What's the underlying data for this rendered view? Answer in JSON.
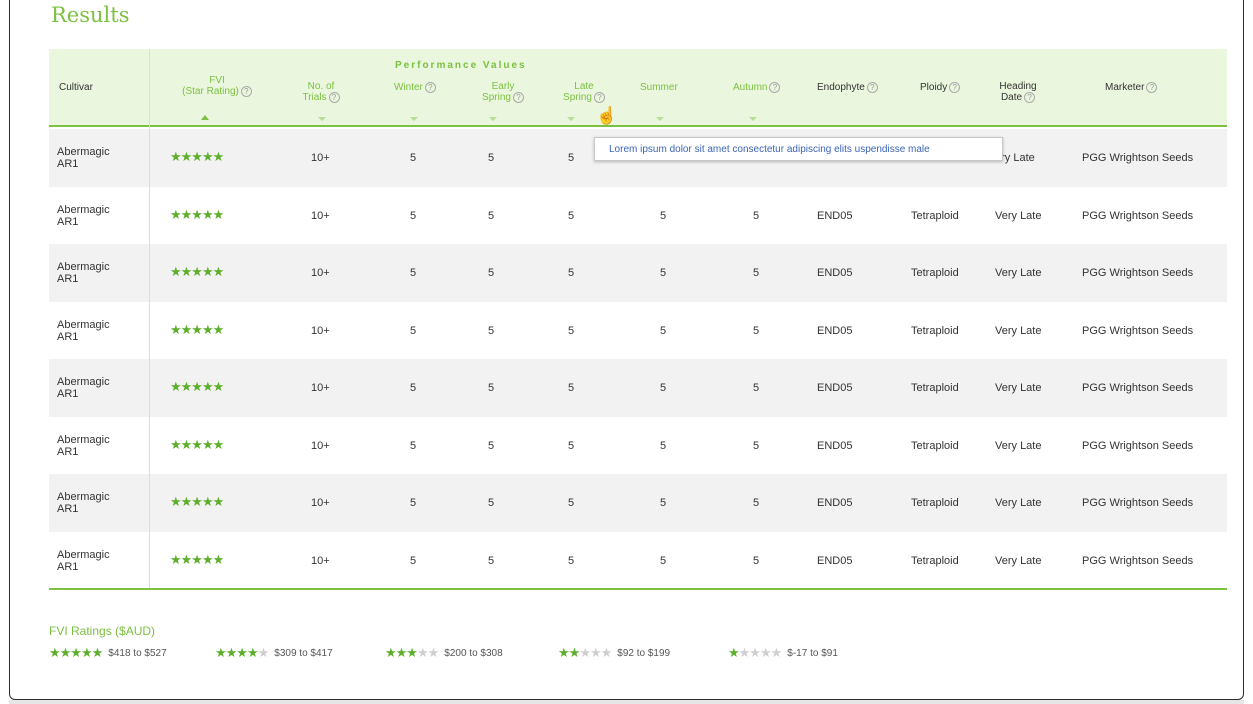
{
  "title": "Results",
  "performance_values_label": "Performance Values",
  "columns": {
    "cultivar": "Cultivar",
    "fvi_line1": "FVI",
    "fvi_line2": "(Star Rating)",
    "trials_line1": "No. of",
    "trials_line2": "Trials",
    "winter": "Winter",
    "early_line1": "Early",
    "early_line2": "Spring",
    "late_line1": "Late",
    "late_line2": "Spring",
    "summer": "Summer",
    "autumn": "Autumn",
    "endophyte": "Endophyte",
    "ploidy": "Ploidy",
    "heading_line1": "Heading",
    "heading_line2": "Date",
    "marketer": "Marketer"
  },
  "help_glyph": "?",
  "tooltip_text": "Lorem ipsum dolor sit amet consectetur adipiscing elits uspendisse male",
  "rows": [
    {
      "cultivar_line1": "Abermagic",
      "cultivar_line2": "AR1",
      "stars": "★★★★★",
      "trials": "10+",
      "winter": "5",
      "early_spring": "5",
      "late_spring": "5",
      "summer": "",
      "autumn": "",
      "endophyte": "",
      "ploidy": "",
      "heading_date": "ery Late",
      "marketer": "PGG Wrightson Seeds"
    },
    {
      "cultivar_line1": "Abermagic",
      "cultivar_line2": "AR1",
      "stars": "★★★★★",
      "trials": "10+",
      "winter": "5",
      "early_spring": "5",
      "late_spring": "5",
      "summer": "5",
      "autumn": "5",
      "endophyte": "END05",
      "ploidy": "Tetraploid",
      "heading_date": "Very Late",
      "marketer": "PGG Wrightson Seeds"
    },
    {
      "cultivar_line1": "Abermagic",
      "cultivar_line2": "AR1",
      "stars": "★★★★★",
      "trials": "10+",
      "winter": "5",
      "early_spring": "5",
      "late_spring": "5",
      "summer": "5",
      "autumn": "5",
      "endophyte": "END05",
      "ploidy": "Tetraploid",
      "heading_date": "Very Late",
      "marketer": "PGG Wrightson Seeds"
    },
    {
      "cultivar_line1": "Abermagic",
      "cultivar_line2": "AR1",
      "stars": "★★★★★",
      "trials": "10+",
      "winter": "5",
      "early_spring": "5",
      "late_spring": "5",
      "summer": "5",
      "autumn": "5",
      "endophyte": "END05",
      "ploidy": "Tetraploid",
      "heading_date": "Very Late",
      "marketer": "PGG Wrightson Seeds"
    },
    {
      "cultivar_line1": "Abermagic",
      "cultivar_line2": "AR1",
      "stars": "★★★★★",
      "trials": "10+",
      "winter": "5",
      "early_spring": "5",
      "late_spring": "5",
      "summer": "5",
      "autumn": "5",
      "endophyte": "END05",
      "ploidy": "Tetraploid",
      "heading_date": "Very Late",
      "marketer": "PGG Wrightson Seeds"
    },
    {
      "cultivar_line1": "Abermagic",
      "cultivar_line2": "AR1",
      "stars": "★★★★★",
      "trials": "10+",
      "winter": "5",
      "early_spring": "5",
      "late_spring": "5",
      "summer": "5",
      "autumn": "5",
      "endophyte": "END05",
      "ploidy": "Tetraploid",
      "heading_date": "Very Late",
      "marketer": "PGG Wrightson Seeds"
    },
    {
      "cultivar_line1": "Abermagic",
      "cultivar_line2": "AR1",
      "stars": "★★★★★",
      "trials": "10+",
      "winter": "5",
      "early_spring": "5",
      "late_spring": "5",
      "summer": "5",
      "autumn": "5",
      "endophyte": "END05",
      "ploidy": "Tetraploid",
      "heading_date": "Very Late",
      "marketer": "PGG Wrightson Seeds"
    },
    {
      "cultivar_line1": "Abermagic",
      "cultivar_line2": "AR1",
      "stars": "★★★★★",
      "trials": "10+",
      "winter": "5",
      "early_spring": "5",
      "late_spring": "5",
      "summer": "5",
      "autumn": "5",
      "endophyte": "END05",
      "ploidy": "Tetraploid",
      "heading_date": "Very Late",
      "marketer": "PGG Wrightson Seeds"
    }
  ],
  "legend": {
    "title": "FVI Ratings ($AUD)",
    "items": [
      {
        "rating": 5,
        "filled": "★★★★★",
        "empty": "",
        "range": "$418 to $527"
      },
      {
        "rating": 4,
        "filled": "★★★★",
        "empty": "★",
        "range": "$309 to $417"
      },
      {
        "rating": 3,
        "filled": "★★★",
        "empty": "★★",
        "range": "$200 to $308"
      },
      {
        "rating": 2,
        "filled": "★★",
        "empty": "★★★",
        "range": "$92 to $199"
      },
      {
        "rating": 1,
        "filled": "★",
        "empty": "★★★★",
        "range": "$-17 to $91"
      }
    ]
  },
  "colors": {
    "accent": "#7cc142",
    "star": "#5cae2b",
    "header_bg": "#eaf6dd",
    "tooltip_text": "#3b63b8"
  },
  "icons": {
    "help": "help-circle-icon",
    "cursor": "hand-pointer-icon",
    "sort_asc": "sort-up-icon",
    "sort_desc": "sort-down-icon"
  }
}
